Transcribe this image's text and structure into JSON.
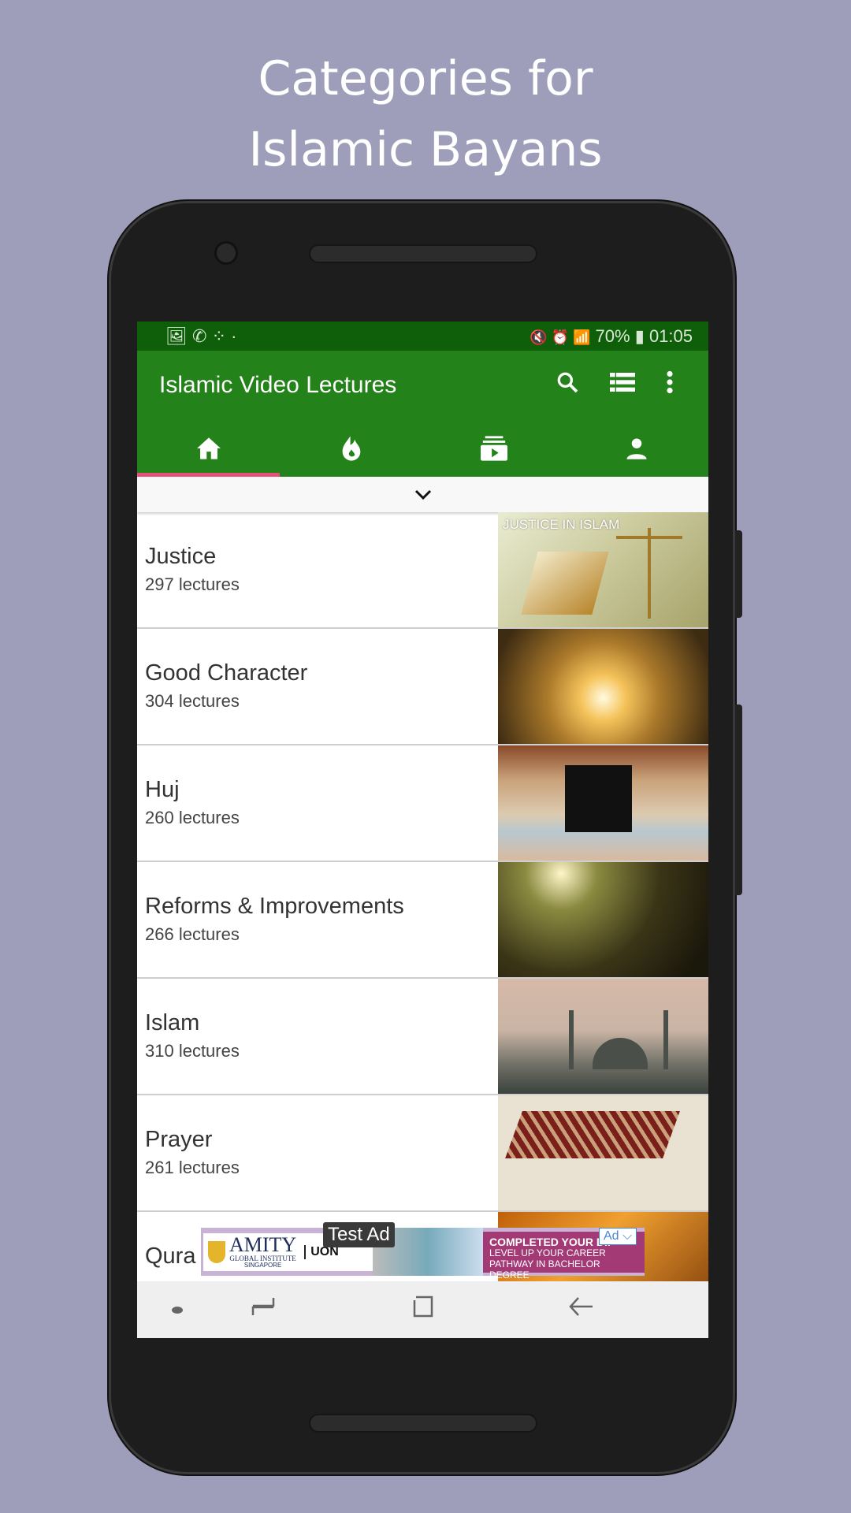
{
  "headline": {
    "line1": "Categories for",
    "line2": "Islamic Bayans"
  },
  "status_bar": {
    "left_icons": "🖼 ✆ ⁘ ·",
    "right_icons": "🔇 ⏰ 📶",
    "battery": "70%",
    "time": "01:05"
  },
  "toolbar": {
    "title": "Islamic Video Lectures",
    "icons": [
      "search-icon",
      "list-icon",
      "more-vert-icon"
    ]
  },
  "tabs": [
    {
      "icon": "home-icon",
      "selected": true
    },
    {
      "icon": "fire-icon"
    },
    {
      "icon": "subscriptions-icon"
    },
    {
      "icon": "person-icon"
    }
  ],
  "accent": {
    "primary": "#23821a",
    "status": "#0f5f0a",
    "indicator": "#e8507a"
  },
  "categories": [
    {
      "name": "Justice",
      "count": "297 lectures",
      "image_label": "JUSTICE IN ISLAM"
    },
    {
      "name": "Good Character",
      "count": "304 lectures"
    },
    {
      "name": "Huj",
      "count": "260 lectures"
    },
    {
      "name": "Reforms & Improvements",
      "count": "266 lectures"
    },
    {
      "name": "Islam",
      "count": "310 lectures"
    },
    {
      "name": "Prayer",
      "count": "261 lectures"
    },
    {
      "name": "Qura",
      "count": ""
    }
  ],
  "ad": {
    "test_label": "Test Ad",
    "badge": "Ad ⌵",
    "brand": "AMITY",
    "brand_sub": "GLOBAL INSTITUTE",
    "brand_loc": "SINGAPORE",
    "partner": "UON",
    "promo1": "COMPLETED YOUR DIP",
    "promo2": "LEVEL UP YOUR CAREER",
    "promo3": "PATHWAY IN BACHELOR DEGREE"
  }
}
